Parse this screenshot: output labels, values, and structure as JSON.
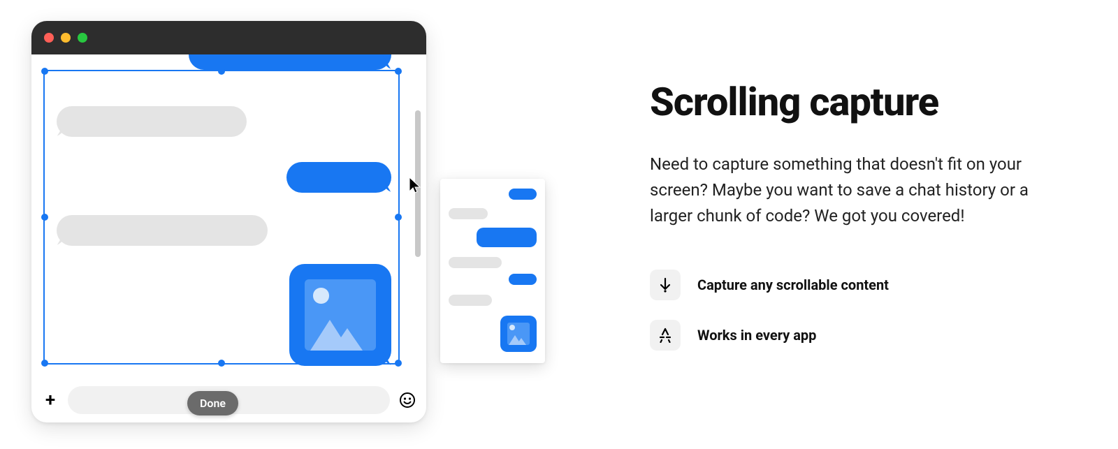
{
  "headline": "Scrolling capture",
  "body": "Need to capture something that doesn't fit on your screen? Maybe you want to save a chat history or a larger chunk of code? We got you covered!",
  "features": [
    {
      "icon": "download-arrow-icon",
      "label": "Capture any scrollable content"
    },
    {
      "icon": "app-store-icon",
      "label": "Works in every app"
    }
  ],
  "selection_tooltip": "Done",
  "colors": {
    "accent": "#1877f2",
    "titlebar": "#2d2d2d",
    "bubble_gray": "#e4e4e4"
  }
}
